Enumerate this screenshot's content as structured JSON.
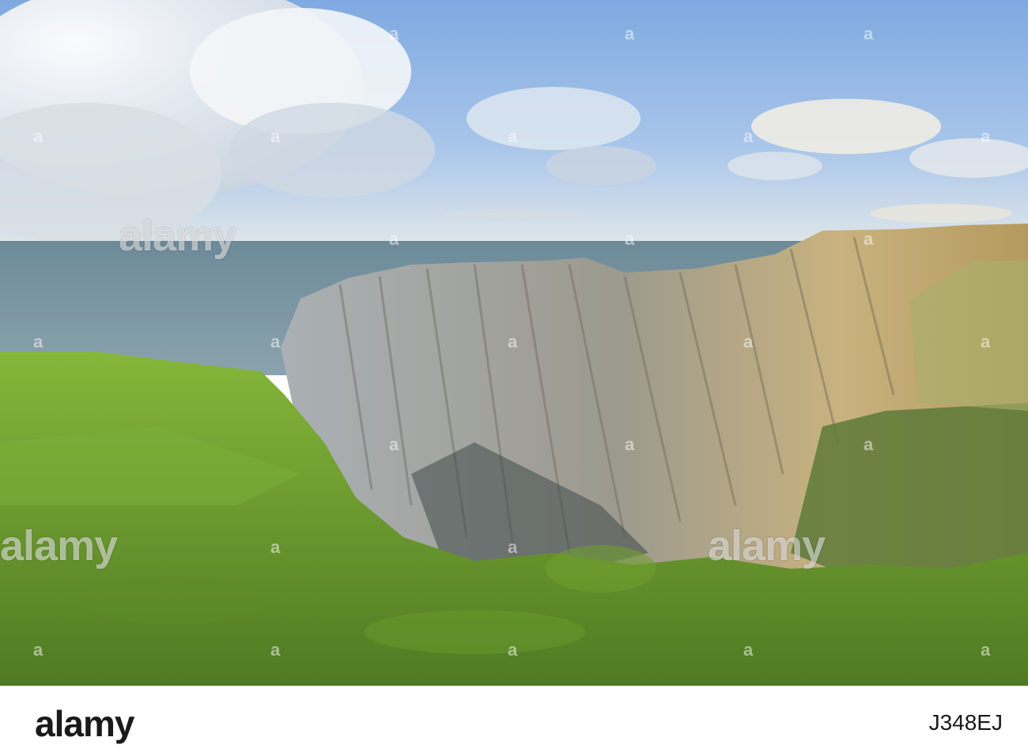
{
  "watermark": {
    "brand": "alamy",
    "mark_glyph": "a"
  },
  "footer": {
    "logo": "alamy",
    "image_id": "J348EJ"
  },
  "colors": {
    "sky": "#8fb7e6",
    "sea": "#5a7684",
    "grass": "#6e9a2e",
    "cliff": "#b8a47a"
  }
}
